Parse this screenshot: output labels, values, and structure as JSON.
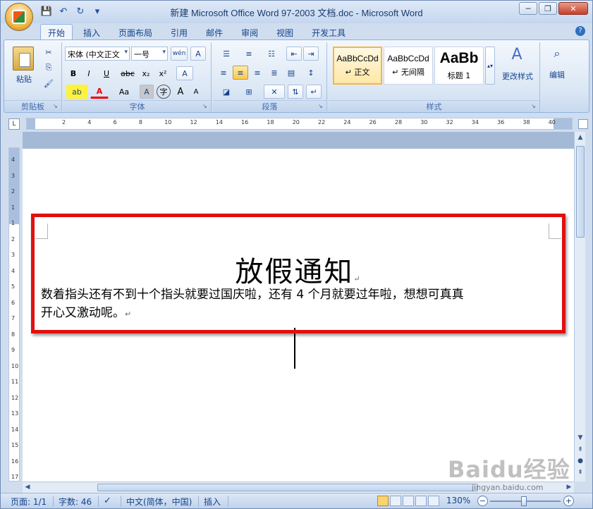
{
  "window": {
    "title": "新建 Microsoft Office Word 97-2003 文档.doc - Microsoft Word",
    "controls": [
      "─",
      "❐",
      "✕"
    ]
  },
  "qat": {
    "save": "💾",
    "undo": "↶",
    "redo": "↻",
    "customize": "▾"
  },
  "tabs": [
    "开始",
    "插入",
    "页面布局",
    "引用",
    "邮件",
    "审阅",
    "视图",
    "开发工具"
  ],
  "active_tab": "开始",
  "ribbon": {
    "clipboard": {
      "label": "剪贴板",
      "paste": "粘贴",
      "cut": "✂",
      "copy": "⎘",
      "format_painter": "🖌"
    },
    "font": {
      "label": "字体",
      "font_name": "宋体 (中文正文",
      "font_size": "一号",
      "phonetic": "wén",
      "char_border": "A",
      "bold": "B",
      "italic": "I",
      "underline": "U",
      "strike": "abc",
      "subscript": "x₂",
      "superscript": "x²",
      "clear": "A",
      "highlight": "ab",
      "font_color": "A",
      "change_case": "Aa",
      "char_shading": "A",
      "enclose": "字",
      "grow": "A",
      "shrink": "A"
    },
    "paragraph": {
      "label": "段落"
    },
    "styles": {
      "label": "样式",
      "items": [
        {
          "sample": "AaBbCcDd",
          "name": "↵ 正文"
        },
        {
          "sample": "AaBbCcDd",
          "name": "↵ 无间隔"
        },
        {
          "sample": "AaBb",
          "name": "标题 1"
        }
      ],
      "change_styles": "更改样式"
    },
    "editing": {
      "label": "编辑"
    }
  },
  "ruler": {
    "tab_marker": "L",
    "h_ticks": [
      "2",
      "4",
      "6",
      "8",
      "10",
      "12",
      "14",
      "16",
      "18",
      "20",
      "22",
      "24",
      "26",
      "28",
      "30",
      "32",
      "34",
      "36",
      "38",
      "40"
    ],
    "v_ticks": [
      "4",
      "3",
      "2",
      "1",
      "1",
      "2",
      "3",
      "4",
      "5",
      "6",
      "7",
      "8",
      "9",
      "10",
      "11",
      "12",
      "13",
      "14",
      "15",
      "16",
      "17"
    ]
  },
  "document": {
    "title": "放假通知",
    "body_line1": "数着指头还有不到十个指头就要过国庆啦，还有 4 个月就要过年啦，想想可真真",
    "body_line2": "开心又激动呢。",
    "para_mark": "↵"
  },
  "status": {
    "page": "页面: 1/1",
    "words": "字数: 46",
    "language": "中文(简体，中国)",
    "mode": "插入",
    "zoom": "130%",
    "zoom_minus": "−",
    "zoom_plus": "+"
  },
  "watermark": {
    "brand": "Baidu经验",
    "url": "jingyan.baidu.com"
  },
  "colors": {
    "highlight_box": "#e20f0f",
    "ribbon_bg": "#dbe7f5",
    "title_text": "#1a3b6b"
  }
}
